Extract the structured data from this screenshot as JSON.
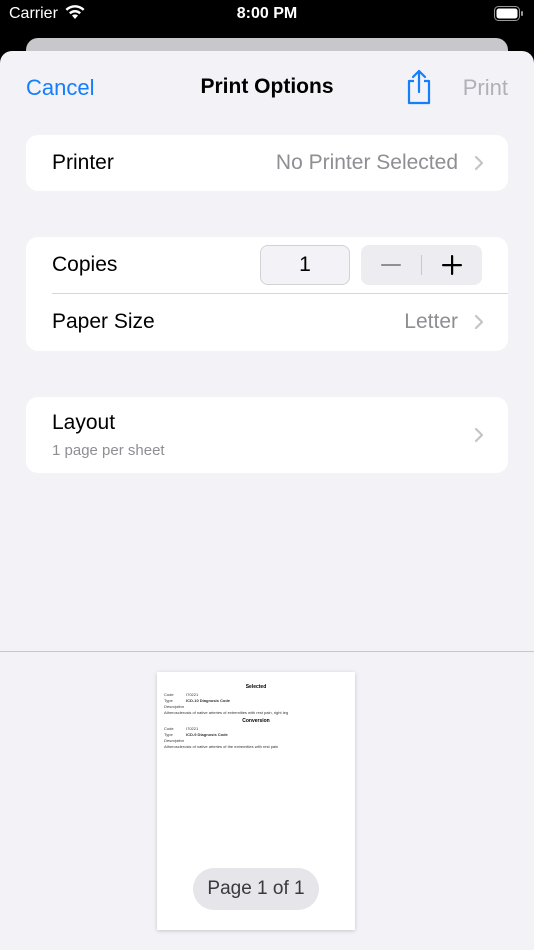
{
  "status_bar": {
    "carrier": "Carrier",
    "time": "8:00 PM"
  },
  "nav": {
    "cancel_label": "Cancel",
    "title": "Print Options",
    "print_label": "Print",
    "share_icon": "share-icon"
  },
  "printer_row": {
    "label": "Printer",
    "value": "No Printer Selected"
  },
  "copies_row": {
    "label": "Copies",
    "value": "1"
  },
  "paper_row": {
    "label": "Paper Size",
    "value": "Letter"
  },
  "layout_row": {
    "label": "Layout",
    "subtitle": "1 page per sheet"
  },
  "preview": {
    "heading_selected": "Selected",
    "heading_conversion": "Conversion",
    "code_label": "Code",
    "type_label": "Type",
    "description_label": "Description",
    "selected_code": "I70221",
    "selected_type": "ICD-10 Diagnosis Code",
    "selected_description": "Atherosclerosis of native arteries of extremities with rest pain, right leg",
    "conversion_code": "I70221",
    "conversion_type": "ICD-9 Diagnosis Code",
    "conversion_description": "Atherosclerosis of native arteries of the extremities with rest pain",
    "page_indicator": "Page 1 of 1"
  },
  "colors": {
    "accent": "#147efb",
    "disabled": "#b0b0b5",
    "background": "#f2f2f7"
  }
}
